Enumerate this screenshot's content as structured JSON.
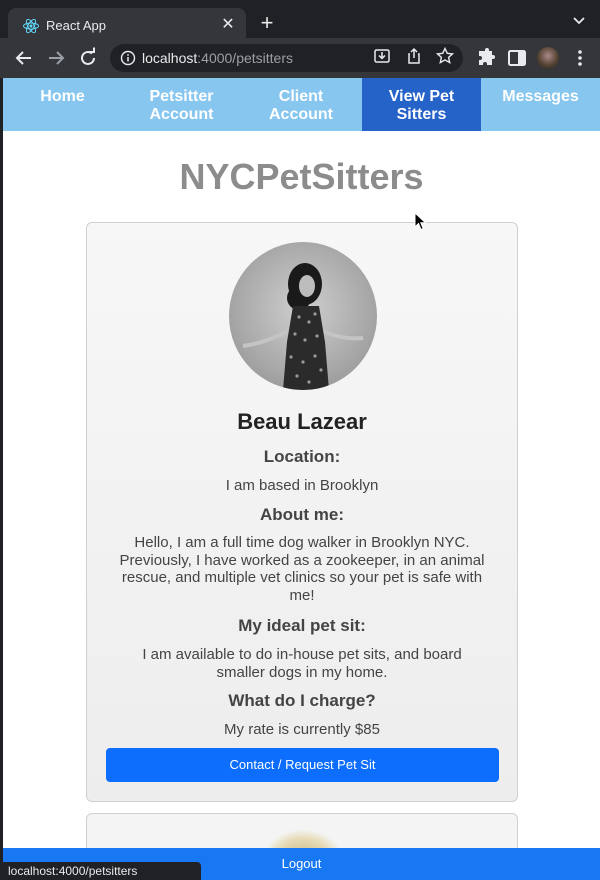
{
  "browser": {
    "tab_title": "React App",
    "url_host": "localhost",
    "url_path": ":4000/petsitters",
    "status_url": "localhost:4000/petsitters",
    "icons": [
      "react-icon",
      "close-icon",
      "plus-icon",
      "back-icon",
      "forward-icon",
      "reload-icon",
      "info-icon",
      "install-icon",
      "share-icon",
      "star-icon",
      "extensions-icon",
      "sidepanel-icon",
      "profile-avatar",
      "menu-icon",
      "chevron-down-icon"
    ]
  },
  "nav": {
    "items": [
      {
        "label": "Home"
      },
      {
        "label": "Petsitter Account"
      },
      {
        "label": "Client Account"
      },
      {
        "label": "View Pet Sitters",
        "active": true
      },
      {
        "label": "Messages"
      }
    ],
    "color": "#87c6ee",
    "active_color": "#2563c9"
  },
  "brand": "NYCPetSitters",
  "sitter": {
    "name": "Beau Lazear",
    "location_heading": "Location:",
    "location": "I am based in Brooklyn",
    "about_heading": "About me:",
    "about": "Hello, I am a full time dog walker in Brooklyn NYC. Previously, I have worked as a zookeeper, in an animal rescue, and multiple vet clinics so your pet is safe with me!",
    "ideal_heading": "My ideal pet sit:",
    "ideal": "I am available to do in-house pet sits, and board smaller dogs in my home.",
    "charge_heading": "What do I charge?",
    "charge": "My rate is currently $85",
    "contact_label": "Contact / Request Pet Sit"
  },
  "logout_label": "Logout",
  "colors": {
    "primary_button": "#0d6efd",
    "logout_bar": "#1877f2",
    "brand_text": "#8c8c8c"
  }
}
